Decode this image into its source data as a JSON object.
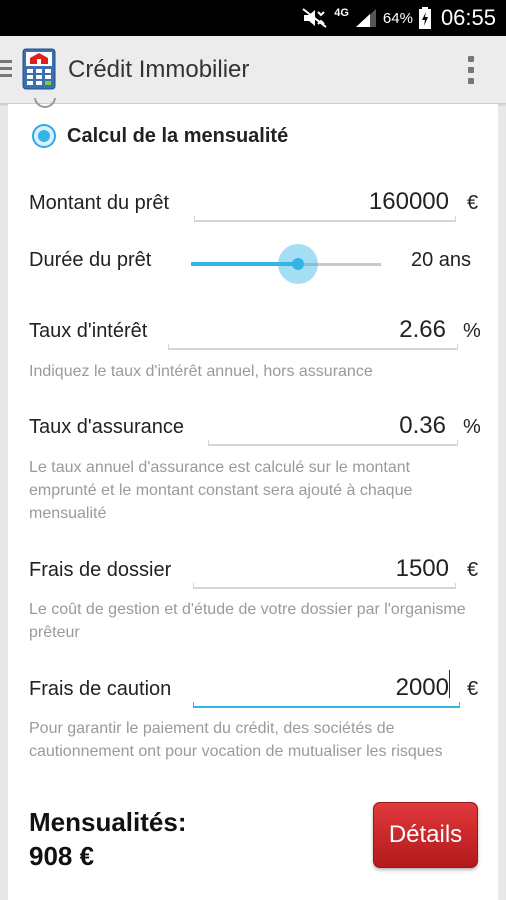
{
  "status_bar": {
    "network": "4G",
    "battery": "64%",
    "time": "06:55"
  },
  "action_bar": {
    "title": "Crédit Immobilier"
  },
  "colors": {
    "accent": "#33b5e5",
    "button": "#c62426"
  },
  "form": {
    "mode_label": "Calcul de la mensualité",
    "loan_amount": {
      "label": "Montant du prêt",
      "value": "160000",
      "unit": "€"
    },
    "duration": {
      "label": "Durée du prêt",
      "value": "20 ans",
      "slider_fraction": 0.56
    },
    "interest": {
      "label": "Taux d'intérêt",
      "value": "2.66",
      "unit": "%",
      "hint": "Indiquez le taux d'intérêt annuel, hors assurance"
    },
    "insurance": {
      "label": "Taux d'assurance",
      "value": "0.36",
      "unit": "%",
      "hint": "Le taux annuel d'assurance est calculé sur le montant emprunté et le montant constant sera ajouté à chaque mensualité"
    },
    "fees": {
      "label": "Frais de dossier",
      "value": "1500",
      "unit": "€",
      "hint": "Le coût de gestion et d'étude de votre dossier par l'organisme prêteur"
    },
    "guarantee": {
      "label": "Frais de caution",
      "value": "2000",
      "unit": "€",
      "hint": "Pour garantir le paiement du crédit, des sociétés de cautionnement ont pour vocation de mutualiser les risques"
    }
  },
  "result": {
    "label": "Mensualités:",
    "value": "908 €",
    "details_button": "Détails"
  }
}
